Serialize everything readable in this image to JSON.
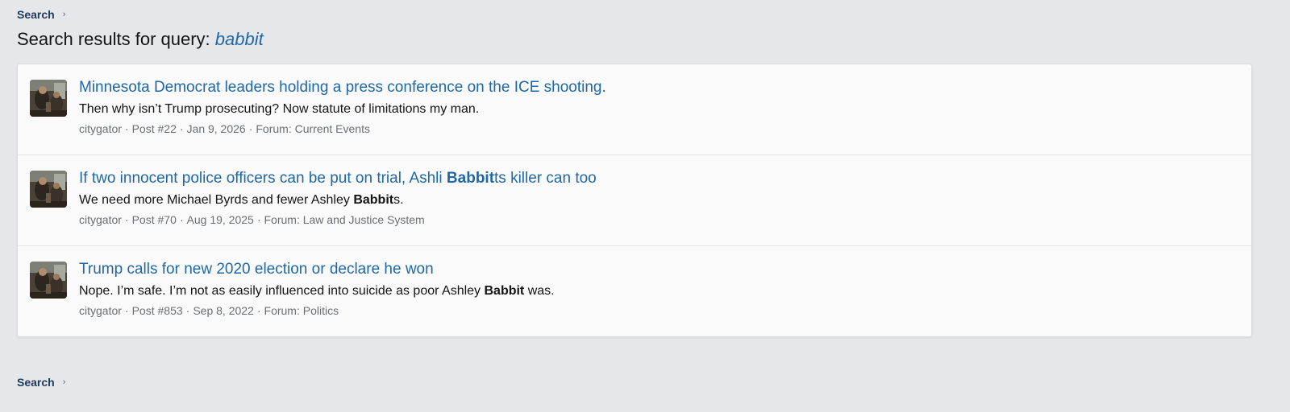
{
  "breadcrumb": {
    "label": "Search"
  },
  "page": {
    "title_prefix": "Search results for query: ",
    "query": "babbit"
  },
  "results": [
    {
      "title_before": "Minnesota Democrat leaders holding a press conference on the ICE shooting.",
      "title_highlight": "",
      "title_after": "",
      "snippet_before": "Then why isn’t Trump prosecuting? Now statute of limitations my man.",
      "snippet_highlight": "",
      "snippet_after": "",
      "author": "citygator",
      "post": "Post #22",
      "date": "Jan 9, 2026",
      "forum": "Forum: Current Events"
    },
    {
      "title_before": "If two innocent police officers can be put on trial, Ashli ",
      "title_highlight": "Babbit",
      "title_after": "ts killer can too",
      "snippet_before": "We need more Michael Byrds and fewer Ashley ",
      "snippet_highlight": "Babbit",
      "snippet_after": "s.",
      "author": "citygator",
      "post": "Post #70",
      "date": "Aug 19, 2025",
      "forum": "Forum: Law and Justice System"
    },
    {
      "title_before": "Trump calls for new 2020 election or declare he won",
      "title_highlight": "",
      "title_after": "",
      "snippet_before": "Nope. I’m safe. I’m not as easily influenced into suicide as poor Ashley ",
      "snippet_highlight": "Babbit",
      "snippet_after": " was.",
      "author": "citygator",
      "post": "Post #853",
      "date": "Sep 8, 2022",
      "forum": "Forum: Politics"
    }
  ],
  "icons": {
    "chevron": "chevron-right-icon",
    "avatar": "user-avatar"
  },
  "colors": {
    "link": "#1f68a5",
    "breadcrumb": "#1d3a5a",
    "background": "#e6e7eb",
    "card": "#fafafa",
    "meta": "#6b6f74"
  }
}
